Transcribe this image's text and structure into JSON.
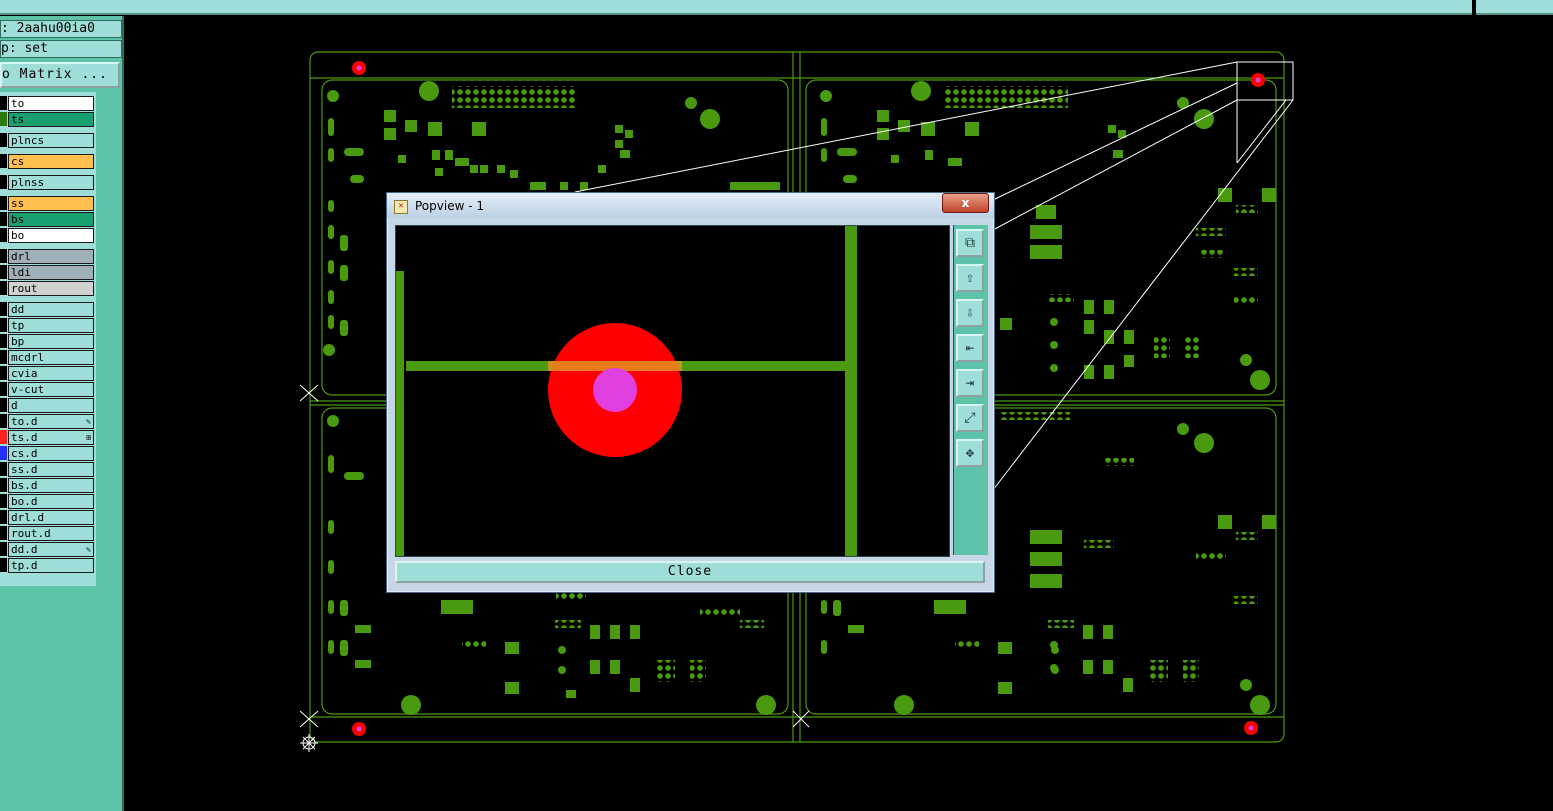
{
  "job": {
    "label": ": 2aahu00ia0"
  },
  "step": {
    "label": "p: set"
  },
  "matrix_button": {
    "label": "o Matrix ..."
  },
  "layers": [
    {
      "name": "to",
      "bg": "#ffffff",
      "swatch": "#000000"
    },
    {
      "name": "ts",
      "bg": "#1aa070",
      "swatch": "#2a7a10"
    },
    {
      "name": "plncs",
      "bg": "#9fded8",
      "swatch": "#000000"
    },
    {
      "name": "cs",
      "bg": "#ffc050",
      "swatch": "#000000"
    },
    {
      "name": "plnss",
      "bg": "#9fded8",
      "swatch": "#000000"
    },
    {
      "name": "ss",
      "bg": "#ffc050",
      "swatch": "#000000"
    },
    {
      "name": "bs",
      "bg": "#1aa070",
      "swatch": "#000000"
    },
    {
      "name": "bo",
      "bg": "#ffffff",
      "swatch": "#000000"
    },
    {
      "name": "drl",
      "bg": "#9fb0b8",
      "swatch": "#000000"
    },
    {
      "name": "ldi",
      "bg": "#9fb0b8",
      "swatch": "#000000"
    },
    {
      "name": "rout",
      "bg": "#d0d0d0",
      "swatch": "#000000"
    },
    {
      "name": "dd",
      "bg": "#9fded8",
      "swatch": "#000000"
    },
    {
      "name": "tp",
      "bg": "#9fded8",
      "swatch": "#000000"
    },
    {
      "name": "bp",
      "bg": "#9fded8",
      "swatch": "#000000"
    },
    {
      "name": "mcdrl",
      "bg": "#9fded8",
      "swatch": "#000000"
    },
    {
      "name": "cvia",
      "bg": "#9fded8",
      "swatch": "#000000"
    },
    {
      "name": "v-cut",
      "bg": "#9fded8",
      "swatch": "#000000"
    },
    {
      "name": "d",
      "bg": "#9fded8",
      "swatch": "#000000"
    },
    {
      "name": "to.d",
      "bg": "#9fded8",
      "swatch": "#000000",
      "mark": "✎"
    },
    {
      "name": "ts.d",
      "bg": "#9fded8",
      "swatch": "#ff2020",
      "mark": "⊞"
    },
    {
      "name": "cs.d",
      "bg": "#9fded8",
      "swatch": "#2030ff"
    },
    {
      "name": "ss.d",
      "bg": "#9fded8",
      "swatch": "#000000"
    },
    {
      "name": "bs.d",
      "bg": "#9fded8",
      "swatch": "#000000"
    },
    {
      "name": "bo.d",
      "bg": "#9fded8",
      "swatch": "#000000"
    },
    {
      "name": "drl.d",
      "bg": "#9fded8",
      "swatch": "#000000"
    },
    {
      "name": "rout.d",
      "bg": "#9fded8",
      "swatch": "#000000"
    },
    {
      "name": "dd.d",
      "bg": "#9fded8",
      "swatch": "#000000",
      "mark": "✎"
    },
    {
      "name": "tp.d",
      "bg": "#9fded8",
      "swatch": "#000000"
    }
  ],
  "popview": {
    "title": "Popview - 1",
    "close_x": "x",
    "close_label": "Close",
    "tools": [
      "zoom-window-icon",
      "zoom-in-icon",
      "zoom-out-icon",
      "pan-left-icon",
      "pan-right-icon",
      "fit-screen-icon",
      "zoom-home-icon"
    ]
  },
  "colors": {
    "panel": "#5cc3a8",
    "panel_light": "#9fded8",
    "copper": "#4a9a10",
    "pad_red": "#ff0000",
    "drill_magenta": "#e040e0"
  }
}
